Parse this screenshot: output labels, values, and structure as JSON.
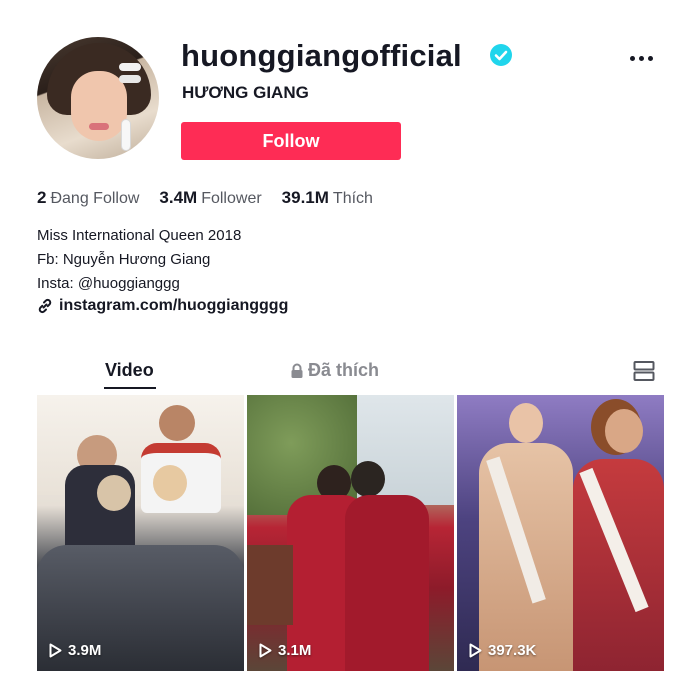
{
  "profile": {
    "username": "huonggiangofficial",
    "display_name": "HƯƠNG GIANG",
    "verified": true,
    "follow_label": "Follow",
    "accent_color": "#fe2c55",
    "verified_color": "#20d5ec"
  },
  "stats": [
    {
      "value": "2",
      "label": "Đang Follow"
    },
    {
      "value": "3.4M",
      "label": "Follower"
    },
    {
      "value": "39.1M",
      "label": "Thích"
    }
  ],
  "bio": {
    "lines": [
      "Miss International Queen 2018",
      "Fb: Nguyễn Hương Giang",
      "Insta: @huoggianggg"
    ],
    "link": "instagram.com/huoggiangggg"
  },
  "tabs": {
    "video": "Video",
    "liked": "Đã thích"
  },
  "videos": [
    {
      "views": "3.9M"
    },
    {
      "views": "3.1M"
    },
    {
      "views": "397.3K"
    }
  ],
  "icons": {
    "verified": "check-badge-icon",
    "more": "more-dots-icon",
    "link": "link-icon",
    "lock": "lock-icon",
    "layout": "grid-layout-icon",
    "play": "play-icon"
  }
}
